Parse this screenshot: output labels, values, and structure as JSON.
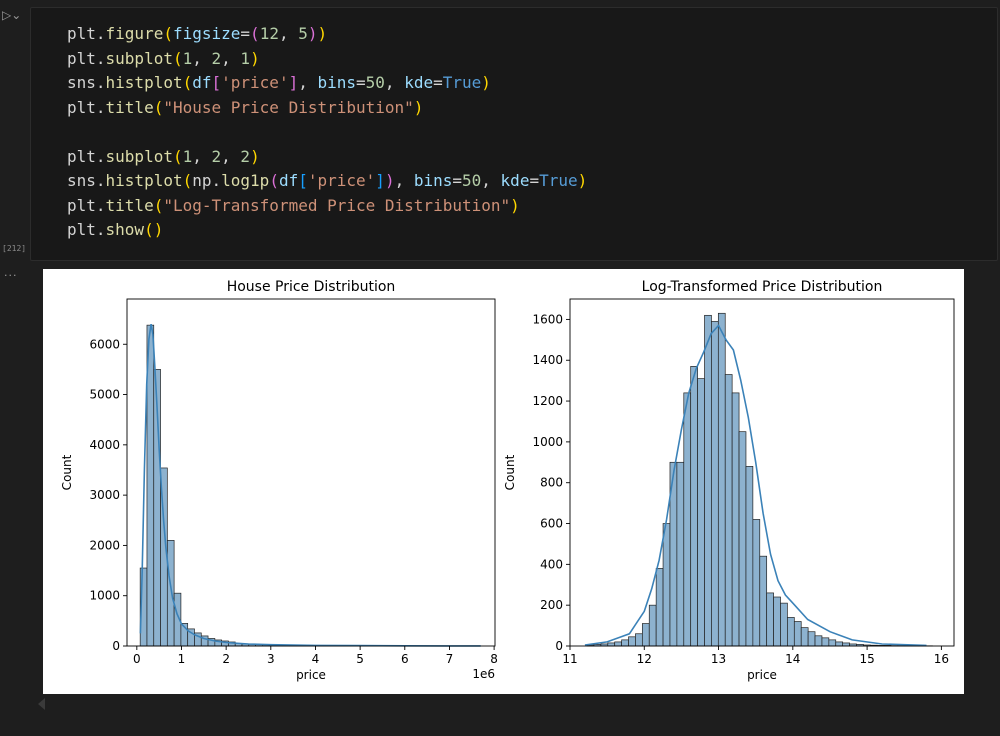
{
  "cell": {
    "exec_count": "[212]",
    "output_dots": "...",
    "code_lines": [
      [
        {
          "t": "plt.",
          "c": "t-plain"
        },
        {
          "t": "figure",
          "c": "t-fn"
        },
        {
          "t": "(",
          "c": "t-p1"
        },
        {
          "t": "figsize",
          "c": "t-kw"
        },
        {
          "t": "=",
          "c": "t-plain"
        },
        {
          "t": "(",
          "c": "t-p2"
        },
        {
          "t": "12",
          "c": "t-num"
        },
        {
          "t": ", ",
          "c": "t-plain"
        },
        {
          "t": "5",
          "c": "t-num"
        },
        {
          "t": ")",
          "c": "t-p2"
        },
        {
          "t": ")",
          "c": "t-p1"
        }
      ],
      [
        {
          "t": "plt.",
          "c": "t-plain"
        },
        {
          "t": "subplot",
          "c": "t-fn"
        },
        {
          "t": "(",
          "c": "t-p1"
        },
        {
          "t": "1",
          "c": "t-num"
        },
        {
          "t": ", ",
          "c": "t-plain"
        },
        {
          "t": "2",
          "c": "t-num"
        },
        {
          "t": ", ",
          "c": "t-plain"
        },
        {
          "t": "1",
          "c": "t-num"
        },
        {
          "t": ")",
          "c": "t-p1"
        }
      ],
      [
        {
          "t": "sns.",
          "c": "t-plain"
        },
        {
          "t": "histplot",
          "c": "t-fn"
        },
        {
          "t": "(",
          "c": "t-p1"
        },
        {
          "t": "df",
          "c": "t-var"
        },
        {
          "t": "[",
          "c": "t-p2"
        },
        {
          "t": "'price'",
          "c": "t-str"
        },
        {
          "t": "]",
          "c": "t-p2"
        },
        {
          "t": ", ",
          "c": "t-plain"
        },
        {
          "t": "bins",
          "c": "t-kw"
        },
        {
          "t": "=",
          "c": "t-plain"
        },
        {
          "t": "50",
          "c": "t-num"
        },
        {
          "t": ", ",
          "c": "t-plain"
        },
        {
          "t": "kde",
          "c": "t-kw"
        },
        {
          "t": "=",
          "c": "t-plain"
        },
        {
          "t": "True",
          "c": "t-bool"
        },
        {
          "t": ")",
          "c": "t-p1"
        }
      ],
      [
        {
          "t": "plt.",
          "c": "t-plain"
        },
        {
          "t": "title",
          "c": "t-fn"
        },
        {
          "t": "(",
          "c": "t-p1"
        },
        {
          "t": "\"House Price Distribution\"",
          "c": "t-str"
        },
        {
          "t": ")",
          "c": "t-p1"
        }
      ],
      [],
      [
        {
          "t": "plt.",
          "c": "t-plain"
        },
        {
          "t": "subplot",
          "c": "t-fn"
        },
        {
          "t": "(",
          "c": "t-p1"
        },
        {
          "t": "1",
          "c": "t-num"
        },
        {
          "t": ", ",
          "c": "t-plain"
        },
        {
          "t": "2",
          "c": "t-num"
        },
        {
          "t": ", ",
          "c": "t-plain"
        },
        {
          "t": "2",
          "c": "t-num"
        },
        {
          "t": ")",
          "c": "t-p1"
        }
      ],
      [
        {
          "t": "sns.",
          "c": "t-plain"
        },
        {
          "t": "histplot",
          "c": "t-fn"
        },
        {
          "t": "(",
          "c": "t-p1"
        },
        {
          "t": "np.",
          "c": "t-plain"
        },
        {
          "t": "log1p",
          "c": "t-fn"
        },
        {
          "t": "(",
          "c": "t-p2"
        },
        {
          "t": "df",
          "c": "t-var"
        },
        {
          "t": "[",
          "c": "t-p3"
        },
        {
          "t": "'price'",
          "c": "t-str"
        },
        {
          "t": "]",
          "c": "t-p3"
        },
        {
          "t": ")",
          "c": "t-p2"
        },
        {
          "t": ", ",
          "c": "t-plain"
        },
        {
          "t": "bins",
          "c": "t-kw"
        },
        {
          "t": "=",
          "c": "t-plain"
        },
        {
          "t": "50",
          "c": "t-num"
        },
        {
          "t": ", ",
          "c": "t-plain"
        },
        {
          "t": "kde",
          "c": "t-kw"
        },
        {
          "t": "=",
          "c": "t-plain"
        },
        {
          "t": "True",
          "c": "t-bool"
        },
        {
          "t": ")",
          "c": "t-p1"
        }
      ],
      [
        {
          "t": "plt.",
          "c": "t-plain"
        },
        {
          "t": "title",
          "c": "t-fn"
        },
        {
          "t": "(",
          "c": "t-p1"
        },
        {
          "t": "\"Log-Transformed Price Distribution\"",
          "c": "t-str"
        },
        {
          "t": ")",
          "c": "t-p1"
        }
      ],
      [
        {
          "t": "plt.",
          "c": "t-plain"
        },
        {
          "t": "show",
          "c": "t-fn"
        },
        {
          "t": "()",
          "c": "t-p1"
        }
      ]
    ]
  },
  "colors": {
    "bar_fill": "#8db2cf",
    "bar_stroke": "#222222",
    "kde": "#3b82b8"
  },
  "chart_data": [
    {
      "type": "bar",
      "title": "House Price Distribution",
      "xlabel": "price",
      "ylabel": "Count",
      "x_offset_label": "1e6",
      "xlim": [
        -0.22,
        8.02
      ],
      "ylim": [
        0,
        6900
      ],
      "xticks": [
        0,
        1,
        2,
        3,
        4,
        5,
        6,
        7,
        8
      ],
      "yticks": [
        0,
        1000,
        2000,
        3000,
        4000,
        5000,
        6000
      ],
      "bin_start": 0.075,
      "bin_width": 0.152,
      "values": [
        1550,
        6380,
        5500,
        3540,
        2100,
        1050,
        450,
        340,
        260,
        200,
        150,
        120,
        100,
        80,
        50,
        40,
        35,
        30,
        25,
        20,
        18,
        15,
        12,
        10,
        8,
        8,
        6,
        6,
        5,
        5,
        4,
        4,
        3,
        3,
        3,
        3,
        2,
        2,
        2,
        2,
        2,
        2,
        1,
        1,
        1,
        1,
        1,
        1,
        1,
        1
      ],
      "kde_x": [
        0.08,
        0.12,
        0.17,
        0.22,
        0.27,
        0.32,
        0.36,
        0.4,
        0.45,
        0.5,
        0.55,
        0.6,
        0.65,
        0.72,
        0.8,
        0.9,
        1.0,
        1.15,
        1.3,
        1.5,
        1.75,
        2.0,
        2.5,
        3.0,
        4.0,
        5.0,
        6.0,
        7.0,
        7.7
      ],
      "kde_y": [
        250,
        1500,
        3500,
        5200,
        6100,
        6400,
        6200,
        5600,
        4800,
        3900,
        3150,
        2500,
        1950,
        1400,
        950,
        640,
        440,
        300,
        220,
        150,
        100,
        70,
        40,
        25,
        12,
        7,
        4,
        2,
        1
      ]
    },
    {
      "type": "bar",
      "title": "Log-Transformed Price Distribution",
      "xlabel": "price",
      "ylabel": "Count",
      "xlim": [
        11.0,
        16.17
      ],
      "ylim": [
        0,
        1700
      ],
      "xticks": [
        11,
        12,
        13,
        14,
        15,
        16
      ],
      "yticks": [
        0,
        200,
        400,
        600,
        800,
        1000,
        1200,
        1400,
        1600
      ],
      "bin_start": 11.23,
      "bin_width": 0.093,
      "values": [
        5,
        8,
        10,
        15,
        20,
        30,
        45,
        60,
        110,
        200,
        380,
        600,
        900,
        900,
        1240,
        1370,
        1310,
        1620,
        1590,
        1630,
        1330,
        1240,
        1050,
        880,
        620,
        440,
        260,
        240,
        210,
        140,
        120,
        90,
        70,
        50,
        40,
        30,
        20,
        15,
        10,
        8,
        5,
        4,
        3,
        3,
        2,
        2,
        2,
        1,
        1,
        1
      ],
      "kde_x": [
        11.2,
        11.5,
        11.8,
        12.0,
        12.1,
        12.2,
        12.3,
        12.4,
        12.5,
        12.6,
        12.7,
        12.8,
        12.9,
        13.0,
        13.1,
        13.2,
        13.3,
        13.4,
        13.5,
        13.6,
        13.7,
        13.8,
        13.9,
        14.0,
        14.2,
        14.5,
        14.8,
        15.2,
        15.8
      ],
      "kde_y": [
        5,
        20,
        60,
        170,
        280,
        420,
        620,
        860,
        1060,
        1240,
        1360,
        1440,
        1530,
        1570,
        1500,
        1450,
        1300,
        1120,
        900,
        650,
        450,
        320,
        250,
        210,
        130,
        70,
        30,
        10,
        3
      ]
    }
  ]
}
